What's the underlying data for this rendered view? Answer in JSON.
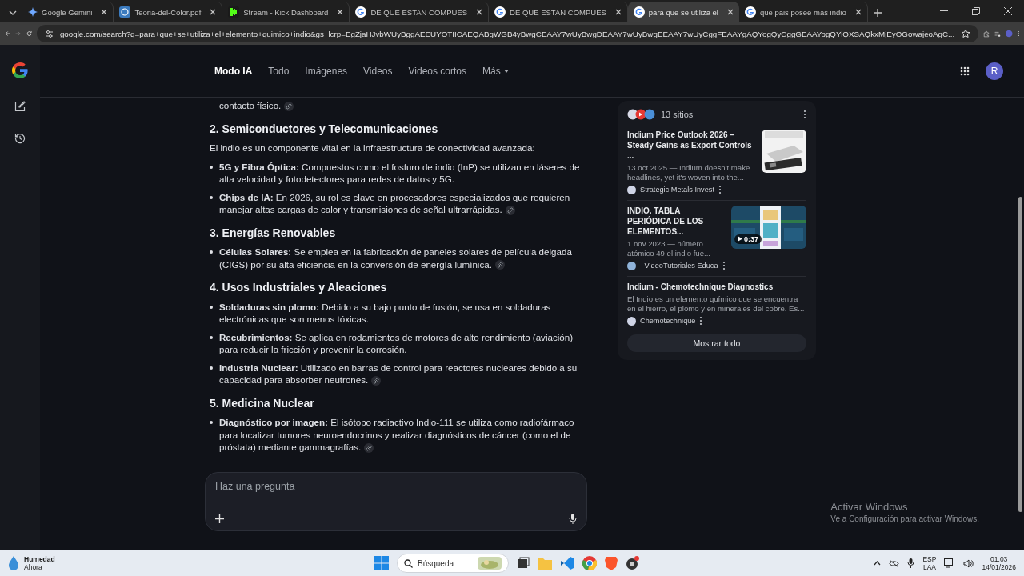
{
  "browser": {
    "tabs": [
      {
        "kind": "gemini",
        "title": "Google Gemini",
        "selected": false
      },
      {
        "kind": "wordpress",
        "title": "Teoria-del-Color.pdf",
        "selected": false
      },
      {
        "kind": "kick",
        "title": "Stream - Kick Dashboard",
        "selected": false
      },
      {
        "kind": "google",
        "title": "DE QUE ESTAN COMPUES",
        "selected": false
      },
      {
        "kind": "google",
        "title": "DE QUE ESTAN COMPUES",
        "selected": false
      },
      {
        "kind": "google",
        "title": "para que se utiliza el",
        "selected": true
      },
      {
        "kind": "google",
        "title": "que pais posee mas indio",
        "selected": false
      }
    ],
    "address": "google.com/search?q=para+que+se+utiliza+el+elemento+quimico+indio&gs_lcrp=EgZjaHJvbWUyBggAEEUYOTIICAEQABgWGB4yBwgCEAAY7wUyBwgDEAAY7wUyBwgEEAAY7wUyCggFEAAYgAQYogQyCggGEAAYogQYiQXSAQkxMjEyOGowajeoAgC..."
  },
  "header": {
    "nav": [
      {
        "label": "Modo IA",
        "selected": true
      },
      {
        "label": "Todo",
        "selected": false
      },
      {
        "label": "Imágenes",
        "selected": false
      },
      {
        "label": "Videos",
        "selected": false
      },
      {
        "label": "Videos cortos",
        "selected": false
      },
      {
        "label": "Más",
        "selected": false
      }
    ],
    "avatar": "R"
  },
  "answer": {
    "lead": "contacto físico.",
    "sections": [
      {
        "heading": "2. Semiconductores y Telecomunicaciones",
        "intro": "El indio es un componente vital en la infraestructura de conectividad avanzada:",
        "bullets": [
          {
            "text": "**5G y Fibra Óptica:** Compuestos como el fosfuro de indio (InP) se utilizan en láseres de alta velocidad y fotodetectores para redes de datos y 5G.",
            "citation": false
          },
          {
            "text": "**Chips de IA:** En 2026, su rol es clave en procesadores especializados que requieren manejar altas cargas de calor y transmisiones de señal ultrarrápidas.",
            "citation": true
          }
        ]
      },
      {
        "heading": "3. Energías Renovables",
        "bullets": [
          {
            "text": "**Células Solares:** Se emplea en la fabricación de paneles solares de película delgada (CIGS) por su alta eficiencia en la conversión de energía lumínica.",
            "citation": true
          }
        ]
      },
      {
        "heading": "4. Usos Industriales y Aleaciones",
        "bullets": [
          {
            "text": "**Soldaduras sin plomo:** Debido a su bajo punto de fusión, se usa en soldaduras electrónicas que son menos tóxicas.",
            "citation": false
          },
          {
            "text": "**Recubrimientos:** Se aplica en rodamientos de motores de alto rendimiento (aviación) para reducir la fricción y prevenir la corrosión.",
            "citation": false
          },
          {
            "text": "**Industria Nuclear:** Utilizado en barras de control para reactores nucleares debido a su capacidad para absorber neutrones.",
            "citation": true
          }
        ]
      },
      {
        "heading": "5. Medicina Nuclear",
        "bullets": [
          {
            "text": "**Diagnóstico por imagen:** El isótopo radiactivo Indio-111 se utiliza como radiofármaco para localizar tumores neuroendocrinos y realizar diagnósticos de cáncer (como el de próstata) mediante gammagrafías.",
            "citation": true
          }
        ]
      }
    ]
  },
  "prompt": {
    "placeholder": "Haz una pregunta"
  },
  "sources": {
    "count": "13 sitios",
    "items": [
      {
        "title": "Indium Price Outlook 2026 – Steady Gains as Export Controls ...",
        "snippet": "13 oct 2025 — Indium doesn't make headlines, yet it's woven into the...",
        "site": "Strategic Metals Invest"
      },
      {
        "title": "INDIO. TABLA PERIÓDICA DE LOS ELEMENTOS...",
        "snippet": "1 nov 2023 — número atómico 49 el indio fue...",
        "site": "· VideoTutoriales Educa",
        "thumbnail": {
          "kind": "picture",
          "duration": "0:37"
        }
      },
      {
        "title": "Indium - Chemotechnique Diagnostics",
        "snippet": "El Indio es un elemento químico que se encuentra en el hierro, el plomo y en minerales del cobre. Es...",
        "site": "Chemotechnique"
      }
    ],
    "button": "Mostrar todo"
  },
  "activation": {
    "title": "Activar Windows",
    "text": "Ve a Configuración para activar Windows."
  },
  "taskbar": {
    "weather": {
      "title": "Humedad",
      "subtitle": "Ahora"
    },
    "search": "Búsqueda",
    "language": "ESP",
    "layout": "LAA",
    "time": "01:03",
    "date": "14/01/2026"
  }
}
